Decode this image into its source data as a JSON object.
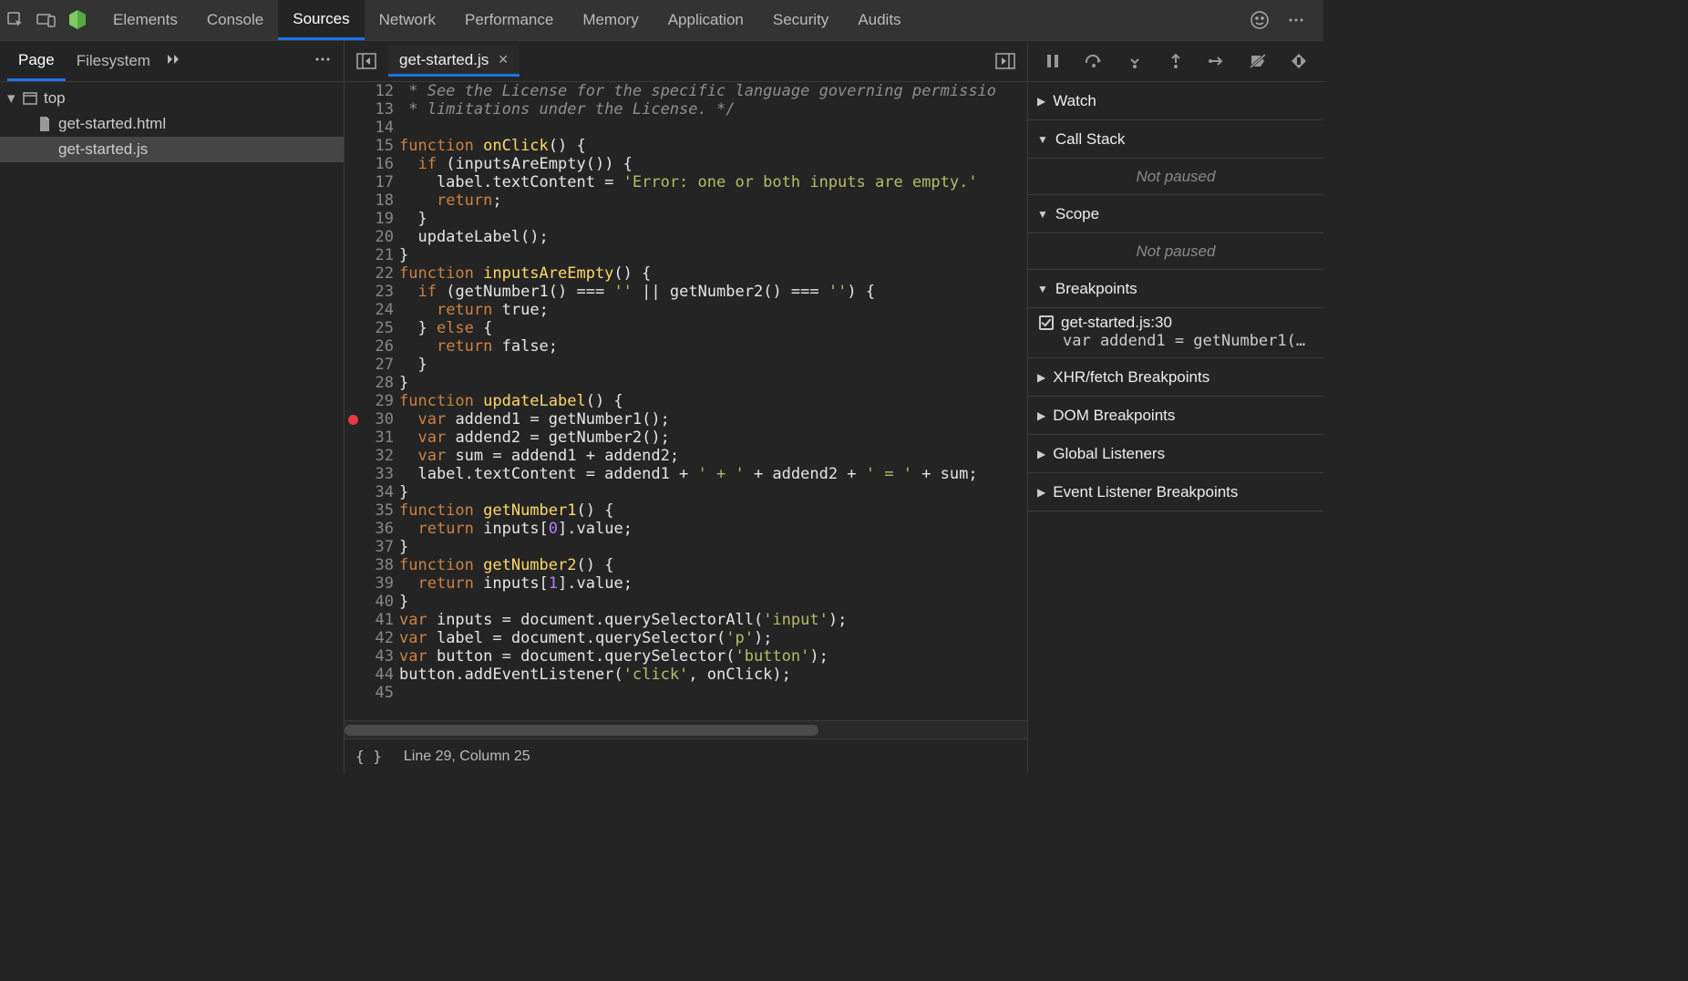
{
  "toolbar": {
    "tabs": [
      "Elements",
      "Console",
      "Sources",
      "Network",
      "Performance",
      "Memory",
      "Application",
      "Security",
      "Audits"
    ],
    "active_tab": "Sources"
  },
  "left": {
    "tabs": [
      "Page",
      "Filesystem"
    ],
    "active_tab": "Page",
    "tree_top": "top",
    "files": [
      "get-started.html",
      "get-started.js"
    ],
    "selected_file": "get-started.js"
  },
  "editor": {
    "open_file": "get-started.js",
    "status": "Line 29, Column 25",
    "breakpoint_line": 30,
    "first_line": 12,
    "lines": [
      [
        [
          "c",
          " * See the License for the specific language governing permissio"
        ]
      ],
      [
        [
          "c",
          " * limitations under the License. */"
        ]
      ],
      [],
      [
        [
          "k",
          "function "
        ],
        [
          "fn",
          "onClick"
        ],
        [
          "d",
          "() {"
        ]
      ],
      [
        [
          "d",
          "  "
        ],
        [
          "k",
          "if"
        ],
        [
          "d",
          " (inputsAreEmpty()) {"
        ]
      ],
      [
        [
          "d",
          "    label.textContent = "
        ],
        [
          "s",
          "'Error: one or both inputs are empty.'"
        ]
      ],
      [
        [
          "d",
          "    "
        ],
        [
          "k",
          "return"
        ],
        [
          "d",
          ";"
        ]
      ],
      [
        [
          "d",
          "  }"
        ]
      ],
      [
        [
          "d",
          "  updateLabel();"
        ]
      ],
      [
        [
          "d",
          "}"
        ]
      ],
      [
        [
          "k",
          "function "
        ],
        [
          "fn",
          "inputsAreEmpty"
        ],
        [
          "d",
          "() {"
        ]
      ],
      [
        [
          "d",
          "  "
        ],
        [
          "k",
          "if"
        ],
        [
          "d",
          " (getNumber1() === "
        ],
        [
          "s",
          "''"
        ],
        [
          "d",
          " || getNumber2() === "
        ],
        [
          "s",
          "''"
        ],
        [
          "d",
          ") {"
        ]
      ],
      [
        [
          "d",
          "    "
        ],
        [
          "k",
          "return "
        ],
        [
          "o",
          "true"
        ],
        [
          "d",
          ";"
        ]
      ],
      [
        [
          "d",
          "  } "
        ],
        [
          "k",
          "else"
        ],
        [
          "d",
          " {"
        ]
      ],
      [
        [
          "d",
          "    "
        ],
        [
          "k",
          "return "
        ],
        [
          "o",
          "false"
        ],
        [
          "d",
          ";"
        ]
      ],
      [
        [
          "d",
          "  }"
        ]
      ],
      [
        [
          "d",
          "}"
        ]
      ],
      [
        [
          "k",
          "function "
        ],
        [
          "fn",
          "updateLabel"
        ],
        [
          "d",
          "() {"
        ]
      ],
      [
        [
          "d",
          "  "
        ],
        [
          "k",
          "var "
        ],
        [
          "d",
          "addend1 = getNumber1();"
        ]
      ],
      [
        [
          "d",
          "  "
        ],
        [
          "k",
          "var "
        ],
        [
          "d",
          "addend2 = getNumber2();"
        ]
      ],
      [
        [
          "d",
          "  "
        ],
        [
          "k",
          "var "
        ],
        [
          "d",
          "sum = addend1 + addend2;"
        ]
      ],
      [
        [
          "d",
          "  label.textContent = addend1 + "
        ],
        [
          "s",
          "' + '"
        ],
        [
          "d",
          " + addend2 + "
        ],
        [
          "s",
          "' = '"
        ],
        [
          "d",
          " + sum;"
        ]
      ],
      [
        [
          "d",
          "}"
        ]
      ],
      [
        [
          "k",
          "function "
        ],
        [
          "fn",
          "getNumber1"
        ],
        [
          "d",
          "() {"
        ]
      ],
      [
        [
          "d",
          "  "
        ],
        [
          "k",
          "return "
        ],
        [
          "d",
          "inputs["
        ],
        [
          "n",
          "0"
        ],
        [
          "d",
          "].value;"
        ]
      ],
      [
        [
          "d",
          "}"
        ]
      ],
      [
        [
          "k",
          "function "
        ],
        [
          "fn",
          "getNumber2"
        ],
        [
          "d",
          "() {"
        ]
      ],
      [
        [
          "d",
          "  "
        ],
        [
          "k",
          "return "
        ],
        [
          "d",
          "inputs["
        ],
        [
          "n",
          "1"
        ],
        [
          "d",
          "].value;"
        ]
      ],
      [
        [
          "d",
          "}"
        ]
      ],
      [
        [
          "k",
          "var "
        ],
        [
          "d",
          "inputs = document.querySelectorAll("
        ],
        [
          "s",
          "'input'"
        ],
        [
          "d",
          ");"
        ]
      ],
      [
        [
          "k",
          "var "
        ],
        [
          "d",
          "label = document.querySelector("
        ],
        [
          "s",
          "'p'"
        ],
        [
          "d",
          ");"
        ]
      ],
      [
        [
          "k",
          "var "
        ],
        [
          "d",
          "button = document.querySelector("
        ],
        [
          "s",
          "'button'"
        ],
        [
          "d",
          ");"
        ]
      ],
      [
        [
          "d",
          "button.addEventListener("
        ],
        [
          "s",
          "'click'"
        ],
        [
          "d",
          ", onClick);"
        ]
      ],
      []
    ]
  },
  "debugger": {
    "panels": {
      "watch": "Watch",
      "callstack": "Call Stack",
      "scope": "Scope",
      "breakpoints": "Breakpoints",
      "xhr": "XHR/fetch Breakpoints",
      "dom": "DOM Breakpoints",
      "global": "Global Listeners",
      "event": "Event Listener Breakpoints"
    },
    "not_paused": "Not paused",
    "breakpoint": {
      "location": "get-started.js:30",
      "code": "var addend1 = getNumber1(…"
    }
  }
}
